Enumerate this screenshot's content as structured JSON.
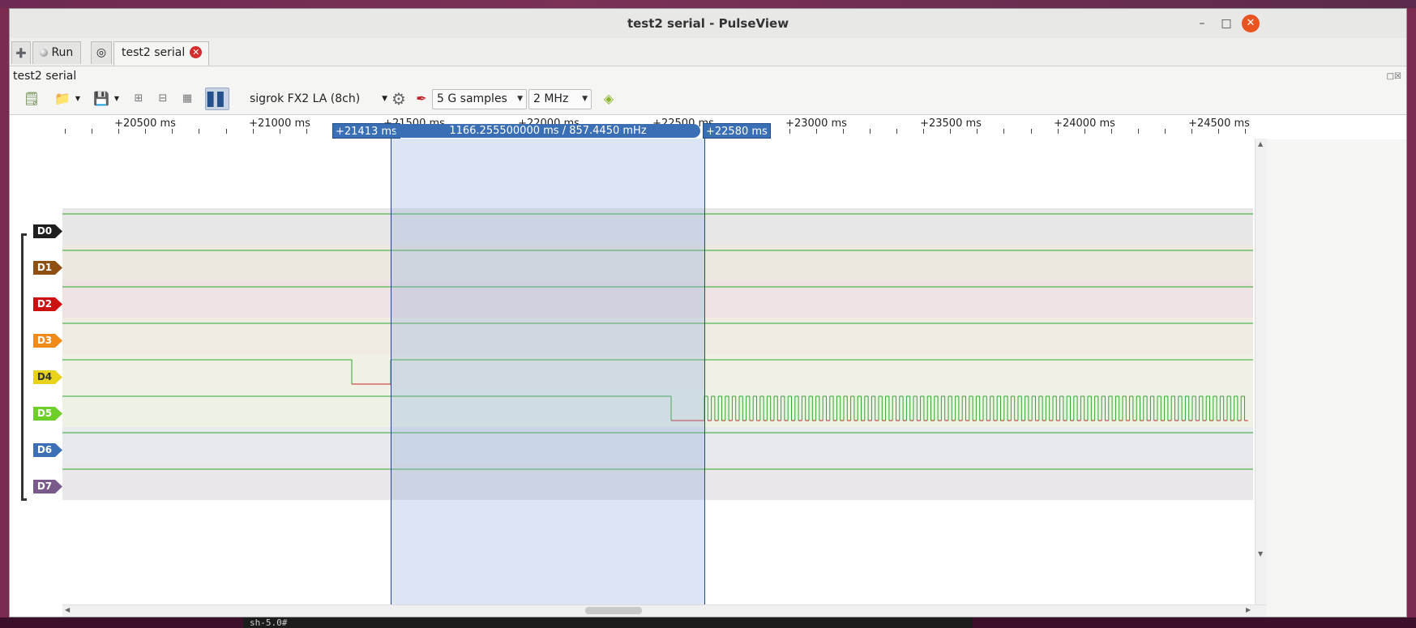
{
  "window": {
    "title": "test2 serial - PulseView"
  },
  "tabs": [
    {
      "label": ""
    },
    {
      "label": "Run"
    },
    {
      "label": ""
    },
    {
      "label": "test2 serial"
    }
  ],
  "session": {
    "label": "test2 serial"
  },
  "toolbar": {
    "device": "sigrok FX2 LA (8ch)",
    "samples": "5 G samples",
    "samplerate": "2 MHz"
  },
  "ruler": {
    "ticks": [
      "+20500 ms",
      "+21000 ms",
      "+21500 ms",
      "+22000 ms",
      "+22500 ms",
      "+23000 ms",
      "+23500 ms",
      "+24000 ms",
      "+24500 ms"
    ],
    "cursor_a": "+21413 ms",
    "cursor_b": "+22580 ms",
    "measurement": "1166.255500000 ms / 857.4450 mHz"
  },
  "channels": [
    {
      "name": "D0",
      "color": "#1f1f1f"
    },
    {
      "name": "D1",
      "color": "#8f4f10"
    },
    {
      "name": "D2",
      "color": "#cc1111"
    },
    {
      "name": "D3",
      "color": "#f08a18"
    },
    {
      "name": "D4",
      "color": "#e8d21a"
    },
    {
      "name": "D5",
      "color": "#6fcf29"
    },
    {
      "name": "D6",
      "color": "#3d6fb6"
    },
    {
      "name": "D7",
      "color": "#7a5a8a"
    }
  ],
  "terminal": {
    "text": "sh-5.0#"
  },
  "colors": {
    "accent": "#3b6fb5",
    "trace_high": "#2eaa2e",
    "trace_low": "#cc2222"
  }
}
